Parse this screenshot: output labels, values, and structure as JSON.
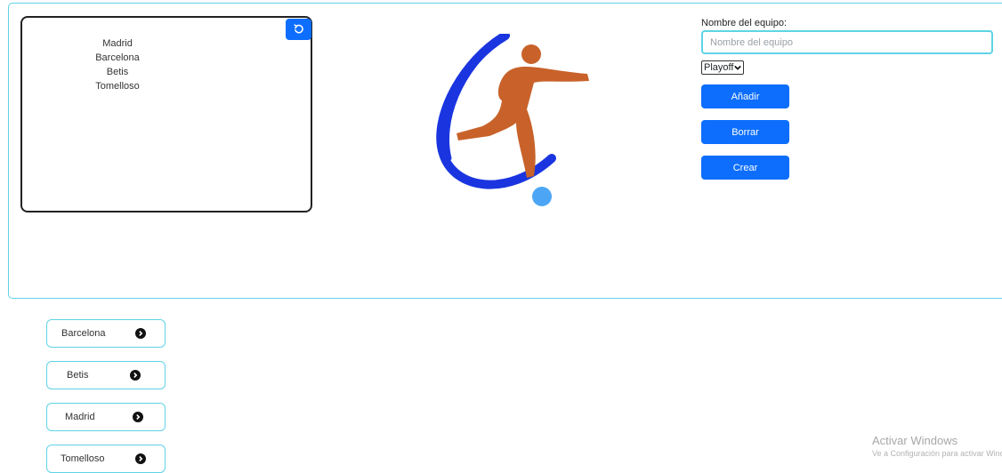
{
  "team_box": {
    "teams": [
      "Madrid",
      "Barcelona",
      "Betis",
      "Tomelloso"
    ],
    "refresh_icon": "refresh-icon"
  },
  "logo": {
    "icon": "football-player-logo",
    "colors": {
      "arc": "#1a35e0",
      "player": "#c8622a",
      "ball": "#4da6f5"
    }
  },
  "form": {
    "label": "Nombre del equipo:",
    "input_value": "",
    "input_placeholder": "Nombre del equipo",
    "select_value": "Playoff",
    "buttons": {
      "add": "Añadir",
      "delete": "Borrar",
      "create": "Crear"
    }
  },
  "cards": [
    {
      "name": "Barcelona",
      "icon": "arrow-right-circle-icon"
    },
    {
      "name": "Betis",
      "icon": "arrow-right-circle-icon"
    },
    {
      "name": "Madrid",
      "icon": "arrow-right-circle-icon"
    },
    {
      "name": "Tomelloso",
      "icon": "arrow-right-circle-icon"
    }
  ],
  "watermark": {
    "title": "Activar Windows",
    "subtitle": "Ve a Configuración para activar Windows."
  },
  "colors": {
    "accent": "#0d6efd",
    "border": "#5fd3e6"
  }
}
